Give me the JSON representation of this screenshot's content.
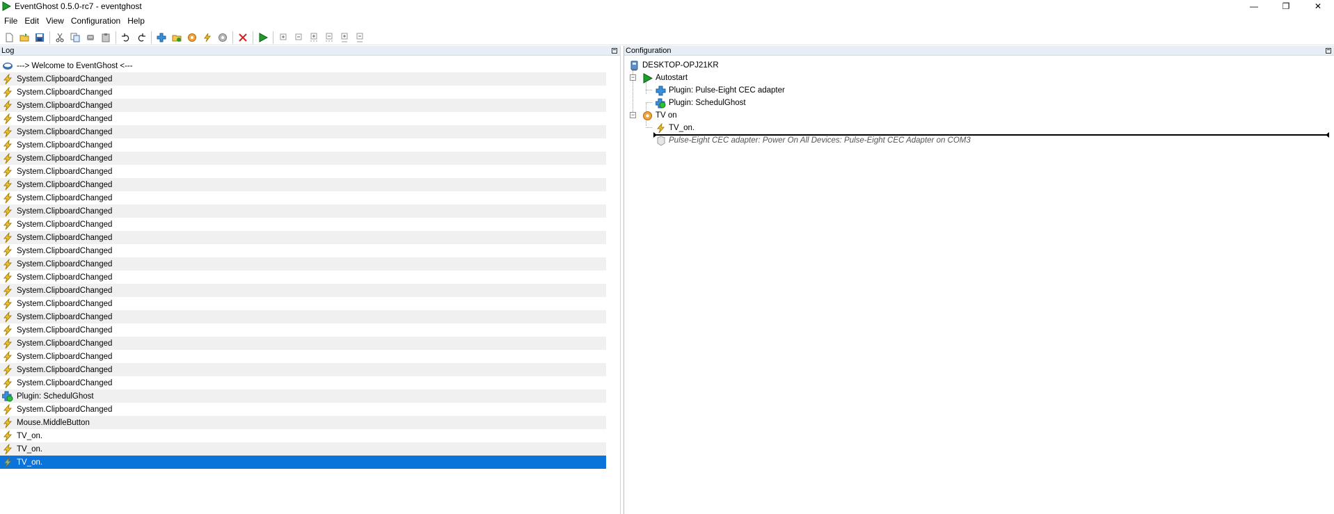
{
  "window": {
    "title": "EventGhost 0.5.0-rc7 - eventghost",
    "controls": {
      "minimize": "—",
      "restore": "❐",
      "close": "✕"
    }
  },
  "menu": [
    "File",
    "Edit",
    "View",
    "Configuration",
    "Help"
  ],
  "toolbar": {
    "icons": [
      "new-file-icon",
      "open-folder-icon",
      "save-icon",
      "cut-icon",
      "copy-icon",
      "python-icon",
      "paste-icon",
      "undo-icon",
      "redo-icon",
      "add-plugin-icon",
      "add-folder-icon",
      "add-macro-icon",
      "add-event-icon",
      "add-action-icon",
      "disable-icon",
      "execute-icon",
      "expand-icon",
      "collapse-icon",
      "expand-children-icon",
      "collapse-children-icon",
      "expand-all-icon",
      "collapse-all-icon"
    ]
  },
  "log": {
    "header": "Log",
    "rows": [
      {
        "type": "info",
        "text": "---> Welcome to EventGhost <---"
      },
      {
        "type": "event",
        "text": "System.ClipboardChanged"
      },
      {
        "type": "event",
        "text": "System.ClipboardChanged"
      },
      {
        "type": "event",
        "text": "System.ClipboardChanged"
      },
      {
        "type": "event",
        "text": "System.ClipboardChanged"
      },
      {
        "type": "event",
        "text": "System.ClipboardChanged"
      },
      {
        "type": "event",
        "text": "System.ClipboardChanged"
      },
      {
        "type": "event",
        "text": "System.ClipboardChanged"
      },
      {
        "type": "event",
        "text": "System.ClipboardChanged"
      },
      {
        "type": "event",
        "text": "System.ClipboardChanged"
      },
      {
        "type": "event",
        "text": "System.ClipboardChanged"
      },
      {
        "type": "event",
        "text": "System.ClipboardChanged"
      },
      {
        "type": "event",
        "text": "System.ClipboardChanged"
      },
      {
        "type": "event",
        "text": "System.ClipboardChanged"
      },
      {
        "type": "event",
        "text": "System.ClipboardChanged"
      },
      {
        "type": "event",
        "text": "System.ClipboardChanged"
      },
      {
        "type": "event",
        "text": "System.ClipboardChanged"
      },
      {
        "type": "event",
        "text": "System.ClipboardChanged"
      },
      {
        "type": "event",
        "text": "System.ClipboardChanged"
      },
      {
        "type": "event",
        "text": "System.ClipboardChanged"
      },
      {
        "type": "event",
        "text": "System.ClipboardChanged"
      },
      {
        "type": "event",
        "text": "System.ClipboardChanged"
      },
      {
        "type": "event",
        "text": "System.ClipboardChanged"
      },
      {
        "type": "event",
        "text": "System.ClipboardChanged"
      },
      {
        "type": "event",
        "text": "System.ClipboardChanged"
      },
      {
        "type": "plugin",
        "text": "Plugin: SchedulGhost"
      },
      {
        "type": "event",
        "text": "System.ClipboardChanged"
      },
      {
        "type": "event",
        "text": "Mouse.MiddleButton"
      },
      {
        "type": "event",
        "text": "TV_on."
      },
      {
        "type": "event",
        "text": "TV_on."
      },
      {
        "type": "event-selected",
        "text": "TV_on."
      }
    ]
  },
  "config": {
    "header": "Configuration",
    "tree": {
      "root": "DESKTOP-OPJ21KR",
      "autostart": "Autostart",
      "plugin1": "Plugin: Pulse-Eight CEC adapter",
      "plugin2": "Plugin: SchedulGhost",
      "macro": "TV on",
      "event": "TV_on.",
      "action": "Pulse-Eight CEC adapter: Power On All Devices: Pulse-Eight CEC Adapter on COM3"
    }
  }
}
